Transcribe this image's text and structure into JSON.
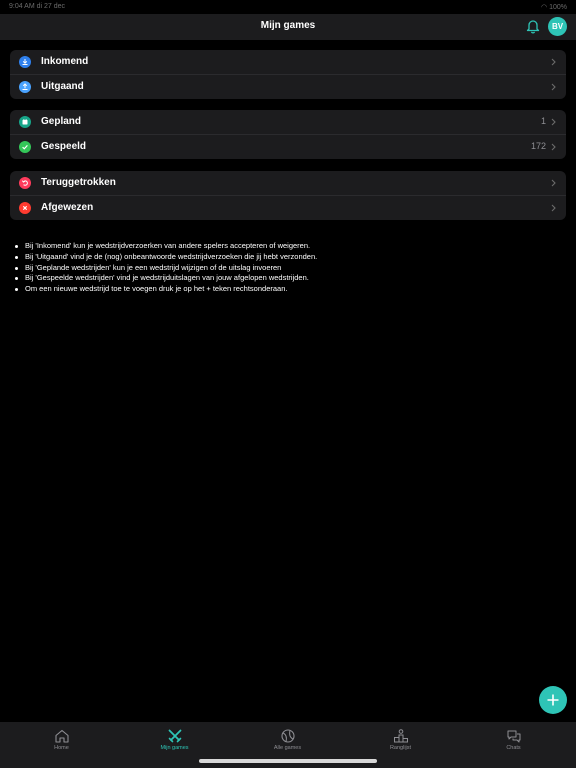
{
  "status_bar": {
    "time": "9:04 AM",
    "date": "di 27 dec",
    "battery": "100%"
  },
  "header": {
    "title": "Mijn games",
    "avatar_initials": "BV"
  },
  "groups": [
    {
      "rows": [
        {
          "label": "Inkomend",
          "count": "",
          "icon": "download-icon",
          "color": "#2f80ed"
        },
        {
          "label": "Uitgaand",
          "count": "",
          "icon": "upload-icon",
          "color": "#4aa3ff"
        }
      ]
    },
    {
      "rows": [
        {
          "label": "Gepland",
          "count": "1",
          "icon": "calendar-icon",
          "color": "#17a589"
        },
        {
          "label": "Gespeeld",
          "count": "172",
          "icon": "check-icon",
          "color": "#34c759"
        }
      ]
    },
    {
      "rows": [
        {
          "label": "Teruggetrokken",
          "count": "",
          "icon": "undo-icon",
          "color": "#ff3b5c"
        },
        {
          "label": "Afgewezen",
          "count": "",
          "icon": "close-icon",
          "color": "#ff3b30"
        }
      ]
    }
  ],
  "info": [
    "Bij 'Inkomend' kun je wedstrijdverzoerken van andere spelers accepteren of weigeren.",
    "Bij 'Uitgaand' vind je de (nog) onbeantwoorde wedstrijdverzoeken die jij hebt verzonden.",
    "Bij 'Geplande wedstrijden' kun je een wedstrijd wijzigen of de uitslag invoeren",
    "Bij 'Gespeelde wedstrijden' vind je wedstrijduitslagen van jouw afgelopen wedstrijden.",
    "Om een nieuwe wedstrijd toe te voegen druk je op het + teken rechtsonderaan."
  ],
  "tabs": [
    {
      "label": "Home",
      "icon": "home-icon",
      "active": false
    },
    {
      "label": "Mijn games",
      "icon": "crossed-swords-icon",
      "active": true
    },
    {
      "label": "Alle games",
      "icon": "ball-icon",
      "active": false
    },
    {
      "label": "Ranglijst",
      "icon": "leaderboard-icon",
      "active": false
    },
    {
      "label": "Chats",
      "icon": "chat-bubbles-icon",
      "active": false
    }
  ],
  "colors": {
    "accent": "#2ec4b6",
    "background": "#000000",
    "card": "#1c1c1e"
  }
}
